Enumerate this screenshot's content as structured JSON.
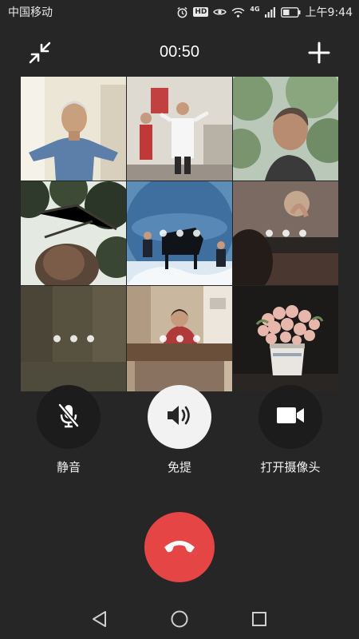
{
  "status_bar": {
    "carrier": "中国移动",
    "hd": "HD",
    "network": "4G",
    "time": "上午9:44"
  },
  "call": {
    "duration": "00:50"
  },
  "participants": [
    {
      "id": "p1",
      "state": "video"
    },
    {
      "id": "p2",
      "state": "video"
    },
    {
      "id": "p3",
      "state": "video"
    },
    {
      "id": "p4",
      "state": "video"
    },
    {
      "id": "p5",
      "state": "connecting"
    },
    {
      "id": "p6",
      "state": "connecting"
    },
    {
      "id": "p7",
      "state": "connecting"
    },
    {
      "id": "p8",
      "state": "connecting"
    },
    {
      "id": "p9",
      "state": "video"
    }
  ],
  "controls": {
    "mute_label": "静音",
    "speaker_label": "免提",
    "camera_label": "打开摄像头"
  },
  "colors": {
    "background": "#262626",
    "hangup": "#e64545",
    "speaker_active": "#f2f2f2",
    "button_dark": "#1c1c1c"
  },
  "icons": {
    "minimize": "minimize-icon",
    "add": "plus-icon",
    "mute": "mic-off-icon",
    "speaker": "speaker-icon",
    "camera": "video-camera-icon",
    "hangup": "phone-hangup-icon"
  }
}
